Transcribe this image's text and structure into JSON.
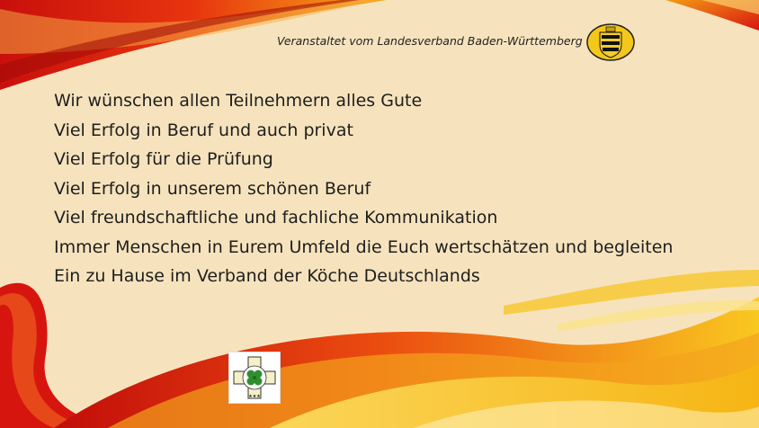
{
  "header": {
    "organizer_text": "Veranstaltet vom Landesverband Baden-Württemberg",
    "crest_icon": "baden-wuerttemberg-crest-icon"
  },
  "main": {
    "lines": [
      "Wir wünschen allen Teilnehmern alles Gute",
      "Viel Erfolg in Beruf und auch privat",
      "Viel Erfolg für die Prüfung",
      "Viel Erfolg in unserem schönen Beruf",
      "Viel freundschaftliche und fachliche Kommunikation",
      "Immer Menschen in Eurem Umfeld die Euch wertschätzen und begleiten",
      "Ein zu Hause im Verband der Köche Deutschlands"
    ]
  },
  "footer": {
    "logo_icon": "verband-der-koeche-logo-icon",
    "logo_text": "VERBAND DER KÖCHE DEUTSCHLANDS"
  },
  "colors": {
    "background": "#f6e3bd",
    "red": "#d8140f",
    "orange": "#f07a10",
    "yellow": "#f8c61a"
  }
}
